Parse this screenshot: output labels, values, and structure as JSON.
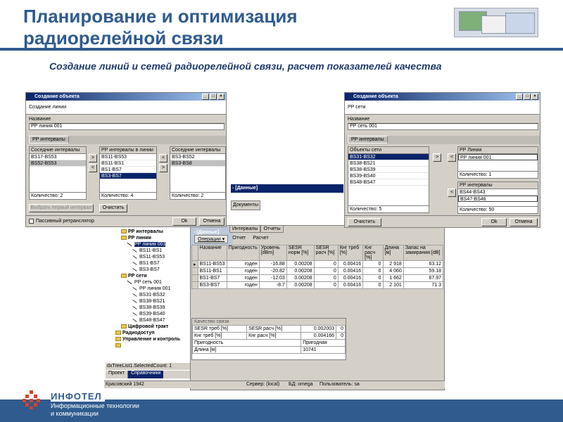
{
  "slide": {
    "title_line1": "Планирование и оптимизация",
    "title_line2": "радиорелейной связи",
    "subtitle": "Создание линий и сетей радиорелейной связи, расчет показателей качества"
  },
  "dialog_line": {
    "title": "Создание объекта",
    "heading": "Создание линии",
    "name_label": "Название",
    "name_value": "РР линия 001",
    "tab": "РР интервалы",
    "left_list": {
      "header": "Соседние интервалы",
      "items": [
        "BS17-BS53",
        "BS52-BS53"
      ],
      "count": "Количество: 2"
    },
    "mid_list": {
      "header": "РР интервалы в линии",
      "items": [
        "BS11-BS53",
        "BS11-BS1",
        "BS1-BS7",
        "BS3-BS7"
      ],
      "count": "Количество: 4"
    },
    "right_list": {
      "header": "Соседние интервалы",
      "items": [
        "BS3-BS52",
        "BS3-BS8"
      ],
      "count": "Количество: 2"
    },
    "arrow_add": ">",
    "arrow_remove": "<",
    "btn_first": "Выбрать первый интервал",
    "btn_clear": "Очистить",
    "passive_label": "Пассивный ретранслятор",
    "btn_ok": "Ok",
    "btn_cancel": "Отмена"
  },
  "dialog_net": {
    "title": "Создание объекта",
    "heading": "РР сети",
    "name_label": "Название",
    "name_value": "РР сеть 001",
    "tab": "РР интервалы",
    "objects": {
      "header": "Объекты сети",
      "items": [
        "BS31-BS32",
        "BS38-BS21",
        "BS38-BS39",
        "BS39-BS40",
        "BS48-BS47"
      ],
      "count": "Количество: 5"
    },
    "lines": {
      "header": "РР Линии",
      "items": [
        "РР линия 001"
      ],
      "count": "Количество: 1"
    },
    "intervals": {
      "header": "РР интервалы",
      "items": [
        "BS44-BS43",
        "BS47-BS46"
      ],
      "count": "Количество: 50"
    },
    "arrow_add": ">",
    "arrow_remove": "<",
    "btn_clear": "Очистить",
    "btn_ok": "Ok",
    "btn_cancel": "Отмена"
  },
  "app": {
    "partial_title": "- [Данные]",
    "doc_tab": "Документы",
    "tabs": [
      "Интервалы",
      "Отчеты"
    ],
    "toolbar": [
      "Операции",
      "Отчет",
      "Расчет"
    ],
    "tree": [
      {
        "label": "РР интервалы",
        "kind": "folder",
        "level": 1
      },
      {
        "label": "РР линии",
        "kind": "folder",
        "level": 1
      },
      {
        "label": "РР линия 001",
        "kind": "line",
        "level": 2,
        "selected": true
      },
      {
        "label": "BS11-BS1",
        "kind": "link",
        "level": 3
      },
      {
        "label": "BS11-BS53",
        "kind": "link",
        "level": 3
      },
      {
        "label": "BS1-BS7",
        "kind": "link",
        "level": 3
      },
      {
        "label": "BS3-BS7",
        "kind": "link",
        "level": 3
      },
      {
        "label": "РР сети",
        "kind": "folder",
        "level": 1
      },
      {
        "label": "РР сеть 001",
        "kind": "line",
        "level": 2
      },
      {
        "label": "РР линия 001",
        "kind": "link",
        "level": 3
      },
      {
        "label": "BS31-BS32",
        "kind": "link",
        "level": 3
      },
      {
        "label": "BS38-BS21",
        "kind": "link",
        "level": 3
      },
      {
        "label": "BS38-BS39",
        "kind": "link",
        "level": 3
      },
      {
        "label": "BS39-BS40",
        "kind": "link",
        "level": 3
      },
      {
        "label": "BS48-BS47",
        "kind": "link",
        "level": 3
      },
      {
        "label": "Цифровой тракт",
        "kind": "folder",
        "level": 1
      },
      {
        "label": "Радиодоступ",
        "kind": "folder",
        "level": 0
      },
      {
        "label": "Управление и контроль",
        "kind": "folder",
        "level": 0
      },
      {
        "label": "",
        "kind": "folder",
        "level": 0
      }
    ],
    "tree_status": "dxTreeList1.SelectedCount: 1",
    "tree_tabs": [
      "Проект",
      "Справочники"
    ],
    "grid_headers": [
      "Название",
      "Пригодность",
      "Уровень [dBm]",
      "SESR норм [%]",
      "SESR расч [%]",
      "Кнг треб [%]",
      "Кнг расч [%]",
      "Длина [м]",
      "Запас на замирания [dB]"
    ],
    "grid_rows": [
      [
        "BS11-BS53",
        "годен",
        "-16.88",
        "0.00208",
        "0",
        "0.00416",
        "0",
        "2 918",
        "63.12"
      ],
      [
        "BS11-BS1",
        "годен",
        "-20.82",
        "0.00208",
        "0",
        "0.00416",
        "0",
        "4 060",
        "59.18"
      ],
      [
        "BS1-BS7",
        "годен",
        "-12.03",
        "0.00208",
        "0",
        "0.00416",
        "0",
        "1 662",
        "67.97"
      ],
      [
        "BS3-BS7",
        "годен",
        "-8.7",
        "0.00208",
        "0",
        "0.00416",
        "0",
        "2 101",
        "71.3"
      ]
    ],
    "quality": {
      "header": "Качество связи",
      "rows": [
        [
          "SESR треб [%]",
          "SESR расч [%]",
          "0.002003",
          "0"
        ],
        [
          "Кнг треб [%]",
          "Кнг расч [%]",
          "0.004166",
          "0"
        ]
      ],
      "suit_label": "Пригодность",
      "suit_value": "Пригодная",
      "len_label": "Длина [м]",
      "len_value": "10741"
    },
    "status": {
      "left": "Красовский 1942",
      "server": "Сервер: (local)",
      "db": "БД: omega",
      "user": "Пользователь: sa"
    }
  },
  "footer": {
    "brand": "ИНФОТЕЛ",
    "line1": "Информационные технологии",
    "line2": "и коммуникации"
  },
  "colors": {
    "brand_blue": "#2f5b8e",
    "title_bar": "#0a246a",
    "selection": "#0a246a"
  }
}
